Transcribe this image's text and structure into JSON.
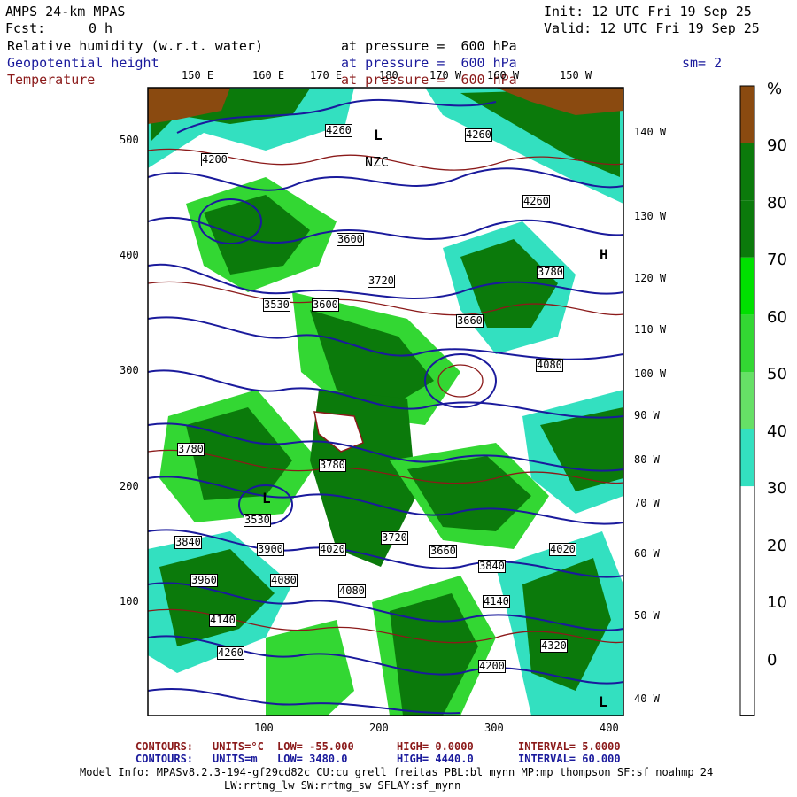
{
  "header": {
    "model_title": "AMPS 24-km MPAS",
    "init_label": "Init: 12 UTC Fri 19 Sep 25",
    "fcst_label": "Fcst:",
    "fcst_value": "0 h",
    "valid_label": "Valid: 12 UTC Fri 19 Sep 25",
    "field1_name": "Relative humidity (w.r.t. water)",
    "field1_level": "at pressure =  600 hPa",
    "field2_name": "Geopotential height",
    "field2_level": "at pressure =  600 hPa",
    "field3_name": "Temperature",
    "field3_level": "at pressure =  600 hPa",
    "smoothing": "sm= 2"
  },
  "top_lon_labels": [
    "150 E",
    "160 E",
    "170 E",
    "180",
    "170 W",
    "160 W",
    "150 W"
  ],
  "right_lon_labels": [
    "140 W",
    "130 W",
    "120 W",
    "110 W",
    "100 W",
    "90 W",
    "80 W",
    "70 W",
    "60 W",
    "50 W",
    "40 W"
  ],
  "y_ticks": [
    "500",
    "400",
    "300",
    "200",
    "100"
  ],
  "x_ticks": [
    "100",
    "200",
    "300",
    "400"
  ],
  "colorbar": {
    "unit": "%",
    "labels": [
      "90",
      "80",
      "70",
      "60",
      "50",
      "40",
      "30",
      "20",
      "10",
      "0"
    ],
    "colors": [
      "#8a4a10",
      "#0b7a0b",
      "#0b7a0b",
      "#00e000",
      "#33d733",
      "#66e066",
      "#33e0c0",
      "#ffffff",
      "#ffffff",
      "#ffffff",
      "#ffffff"
    ]
  },
  "contour_labels": {
    "height": [
      "4260",
      "4200",
      "4260",
      "4260",
      "3600",
      "3660",
      "3840",
      "3720",
      "3780",
      "3720",
      "3780",
      "3780",
      "3840",
      "3900",
      "3960",
      "4020",
      "4080",
      "4080",
      "4080",
      "4020",
      "4140",
      "4200",
      "4260",
      "4320",
      "4140",
      "3530",
      "3530",
      "3600",
      "3660"
    ],
    "features": [
      "L",
      "L",
      "L",
      "H",
      "NZC"
    ]
  },
  "footer": {
    "line1_label": "CONTOURS:",
    "line1_units": "UNITS=°C",
    "line1_low": "LOW= -55.000",
    "line1_high": "HIGH= 0.0000",
    "line1_interval": "INTERVAL= 5.0000",
    "line2_label": "CONTOURS:",
    "line2_units": "UNITS=m",
    "line2_low": "LOW= 3480.0",
    "line2_high": "HIGH= 4440.0",
    "line2_interval": "INTERVAL= 60.000",
    "model_info": "Model Info: MPASv8.2.3-194-gf29cd82c CU:cu_grell_freitas PBL:bl_mynn MP:mp_thompson SF:sf_noahmp 24",
    "model_info2": "LW:rrtmg_lw SW:rrtmg_sw SFLAY:sf_mynn"
  },
  "colors": {
    "height_contour": "#1a1a9c",
    "temp_contour": "#8b1a1a",
    "rh_dark": "#0b7a0b",
    "rh_mid": "#33d733",
    "rh_light": "#33e0c0",
    "land": "#8a4a10"
  }
}
